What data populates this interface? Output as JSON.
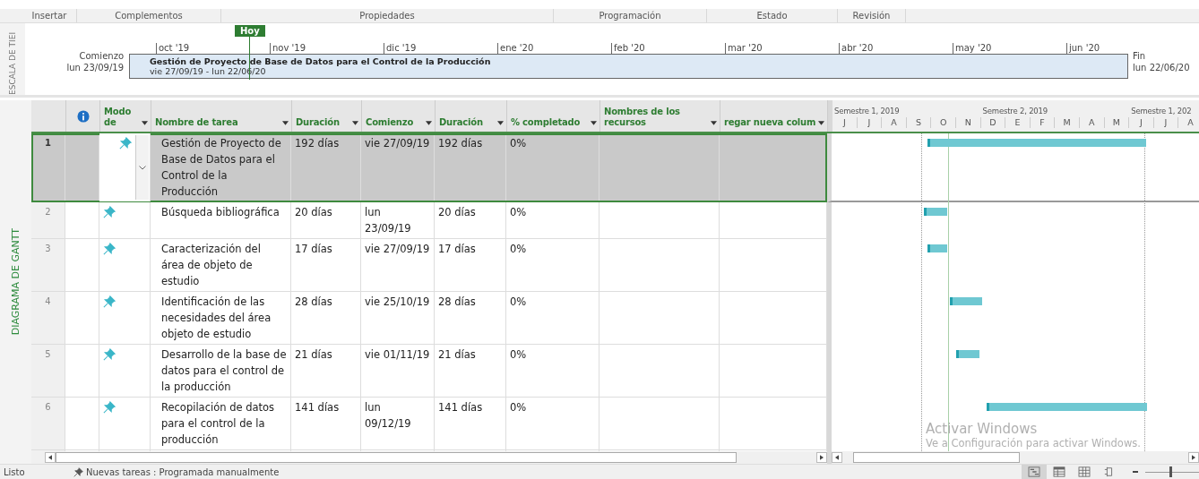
{
  "ribbon_groups": [
    "Insertar",
    "Complementos",
    "Propiedades",
    "Programación",
    "Estado",
    "Revisión"
  ],
  "timeline": {
    "side_label": "ESCALA DE TIEI",
    "start_label": "Comienzo",
    "start_date": "lun 23/09/19",
    "today_label": "Hoy",
    "ticks": [
      "oct '19",
      "nov '19",
      "dic '19",
      "ene '20",
      "feb '20",
      "mar '20",
      "abr '20",
      "may '20",
      "jun '20"
    ],
    "bar_title": "Gestión de Proyecto de Base de Datos para el Control de la Producción",
    "bar_dates": "vie 27/09/19 - lun 22/06/20",
    "end_label": "Fin",
    "end_date": "lun 22/06/20"
  },
  "view_label": "DIAGRAMA DE GANTT",
  "table": {
    "columns": [
      {
        "kind": "icon"
      },
      {
        "kind": "text",
        "label": "Modo de"
      },
      {
        "kind": "text",
        "label": "Nombre de tarea"
      },
      {
        "kind": "text",
        "label": "Duración"
      },
      {
        "kind": "text",
        "label": "Comienzo"
      },
      {
        "kind": "text",
        "label": "Duración"
      },
      {
        "kind": "text",
        "label": "% completado"
      },
      {
        "kind": "text",
        "label": "Nombres de los recursos"
      },
      {
        "kind": "text",
        "label": "regar nueva colum"
      }
    ],
    "rows": [
      {
        "number": "1",
        "name": "Gestión de Proyecto de Base de Datos para el Control de la Producción",
        "duration": "192 días",
        "start": "vie 27/09/19",
        "duration_2": "192 días",
        "complete": "0%",
        "selected": true
      },
      {
        "number": "2",
        "name": "Búsqueda bibliográfica",
        "duration": "20 días",
        "start": "lun 23/09/19",
        "duration_2": "20 días",
        "complete": "0%",
        "selected": false
      },
      {
        "number": "3",
        "name": "Caracterización del área de objeto de estudio",
        "duration": "17 días",
        "start": "vie 27/09/19",
        "duration_2": "17 días",
        "complete": "0%",
        "selected": false
      },
      {
        "number": "4",
        "name": "Identificación de las necesidades del área objeto de estudio",
        "duration": "28 días",
        "start": "vie 25/10/19",
        "duration_2": "28 días",
        "complete": "0%",
        "selected": false
      },
      {
        "number": "5",
        "name": "Desarrollo de la base de datos para el control de la producción",
        "duration": "21 días",
        "start": "vie 01/11/19",
        "duration_2": "21 días",
        "complete": "0%",
        "selected": false
      },
      {
        "number": "6",
        "name": "Recopilación de datos para el control de la producción",
        "duration": "141 días",
        "start": "lun 09/12/19",
        "duration_2": "141 días",
        "complete": "0%",
        "selected": false
      }
    ]
  },
  "gantt": {
    "semesters": [
      "Semestre 1, 2019",
      "Semestre 2, 2019",
      "Semestre 1, 202"
    ],
    "months": [
      "J",
      "J",
      "A",
      "S",
      "O",
      "N",
      "D",
      "E",
      "F",
      "M",
      "A",
      "M",
      "J",
      "J",
      "A"
    ]
  },
  "activation_notice": {
    "title": "Activar Windows",
    "text": "Ve a Configuración para activar Windows."
  },
  "status_bar": {
    "status": "Listo",
    "new_tasks": "Nuevas tareas : Programada manualmente",
    "zoom": {
      "level": 0.45
    }
  }
}
